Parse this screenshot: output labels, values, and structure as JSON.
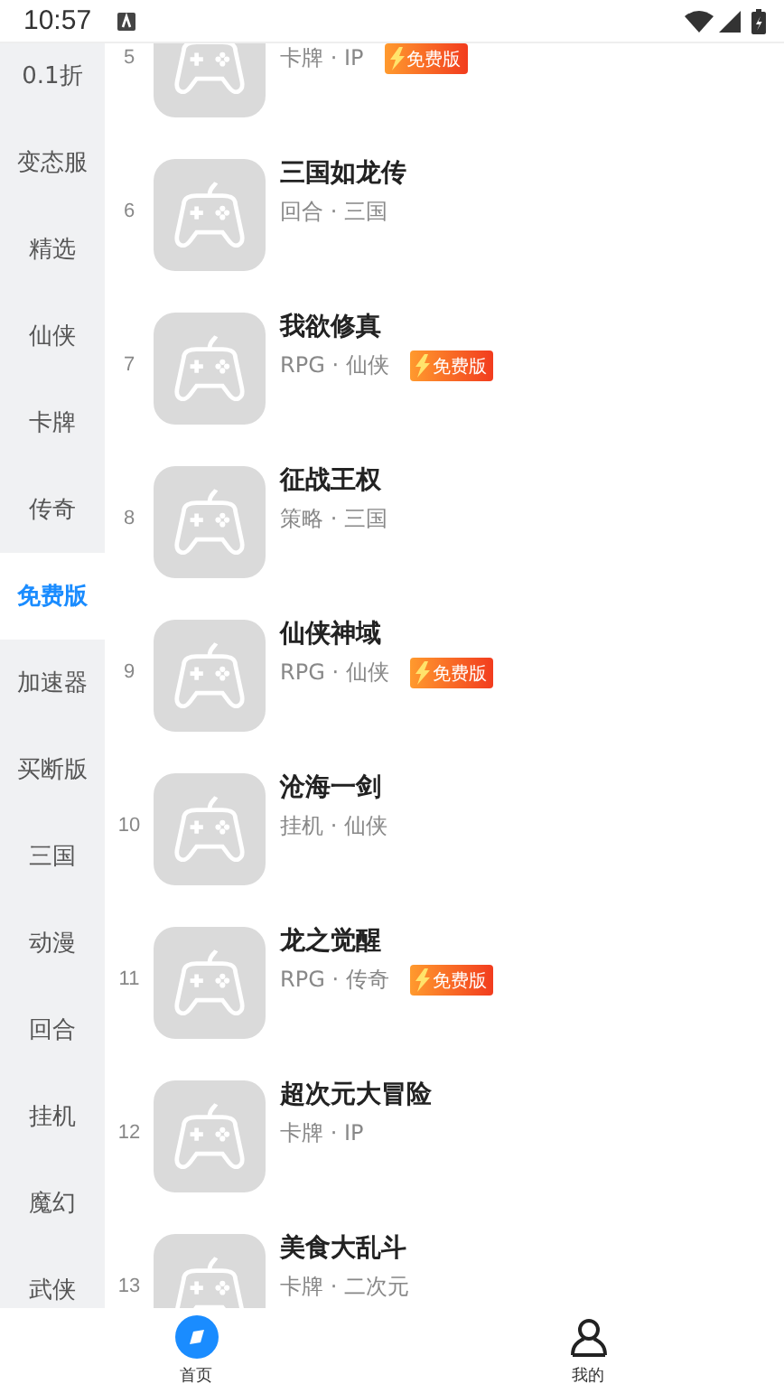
{
  "status_bar": {
    "time": "10:57"
  },
  "categories": [
    {
      "label": "0.1折",
      "selected": false
    },
    {
      "label": "变态服",
      "selected": false
    },
    {
      "label": "精选",
      "selected": false
    },
    {
      "label": "仙侠",
      "selected": false
    },
    {
      "label": "卡牌",
      "selected": false
    },
    {
      "label": "传奇",
      "selected": false
    },
    {
      "label": "免费版",
      "selected": true
    },
    {
      "label": "加速器",
      "selected": false
    },
    {
      "label": "买断版",
      "selected": false
    },
    {
      "label": "三国",
      "selected": false
    },
    {
      "label": "动漫",
      "selected": false
    },
    {
      "label": "回合",
      "selected": false
    },
    {
      "label": "挂机",
      "selected": false
    },
    {
      "label": "魔幻",
      "selected": false
    },
    {
      "label": "武侠",
      "selected": false
    }
  ],
  "games": [
    {
      "rank": "5",
      "meta": "卡牌 · IP",
      "badge": "免费版"
    },
    {
      "rank": "6",
      "title": "三国如龙传",
      "meta": "回合 · 三国"
    },
    {
      "rank": "7",
      "title": "我欲修真",
      "meta": "RPG · 仙侠",
      "badge": "免费版"
    },
    {
      "rank": "8",
      "title": "征战王权",
      "meta": "策略 · 三国"
    },
    {
      "rank": "9",
      "title": "仙侠神域",
      "meta": "RPG · 仙侠",
      "badge": "免费版"
    },
    {
      "rank": "10",
      "title": "沧海一剑",
      "meta": "挂机 · 仙侠"
    },
    {
      "rank": "11",
      "title": "龙之觉醒",
      "meta": "RPG · 传奇",
      "badge": "免费版"
    },
    {
      "rank": "12",
      "title": "超次元大冒险",
      "meta": "卡牌 · IP"
    },
    {
      "rank": "13",
      "title": "美食大乱斗",
      "meta": "卡牌 · 二次元"
    }
  ],
  "bottom_nav": [
    {
      "label": "首页",
      "kind": "home",
      "selected": true
    },
    {
      "label": "我的",
      "kind": "profile",
      "selected": false
    }
  ]
}
